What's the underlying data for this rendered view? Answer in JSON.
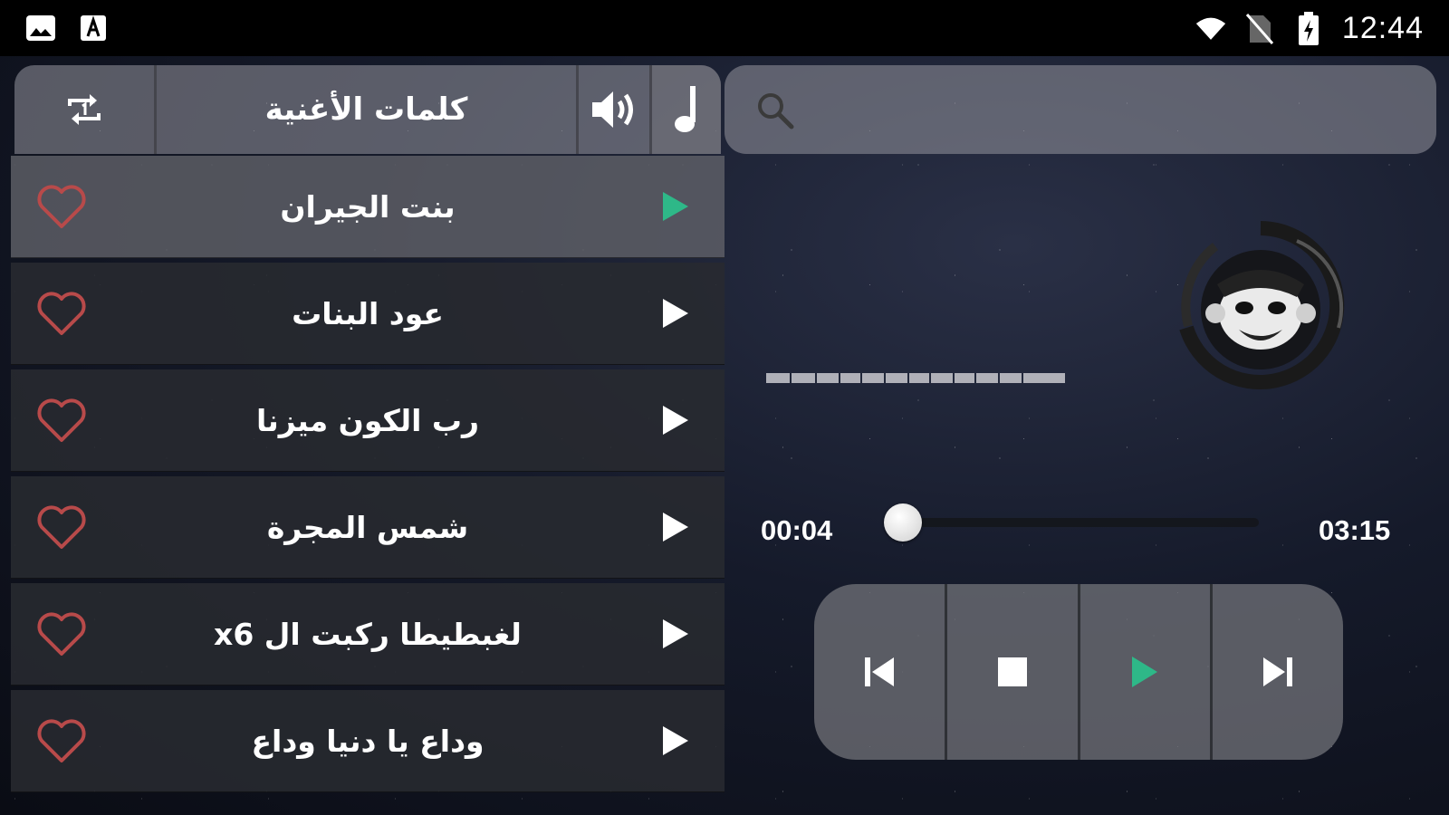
{
  "status_bar": {
    "time": "12:44",
    "left_icons": [
      "image-icon",
      "font-a-icon"
    ],
    "right_icons": [
      "wifi-icon",
      "no-sim-icon",
      "battery-charging-icon"
    ]
  },
  "header": {
    "lyrics_label": "كلمات الأغنية",
    "icons": [
      "repeat-one-icon",
      "volume-icon",
      "music-note-icon"
    ]
  },
  "songs": [
    {
      "title": "بنت الجيران",
      "active": true
    },
    {
      "title": "عود البنات",
      "active": false
    },
    {
      "title": "رب الكون ميزنا",
      "active": false
    },
    {
      "title": "شمس المجرة",
      "active": false
    },
    {
      "title": "لغبطيطا ركبت ال x6",
      "active": false
    },
    {
      "title": "وداع يا دنيا وداع",
      "active": false
    }
  ],
  "search": {
    "value": "",
    "placeholder": ""
  },
  "player": {
    "current_time": "00:04",
    "duration": "03:15",
    "progress": 0.02
  },
  "controls": [
    "previous-icon",
    "stop-icon",
    "play-icon",
    "next-icon"
  ],
  "colors": {
    "accent": "#2eb888",
    "heart": "#b84a4a",
    "panel": "#28292f",
    "active_row": "#5f6068"
  }
}
